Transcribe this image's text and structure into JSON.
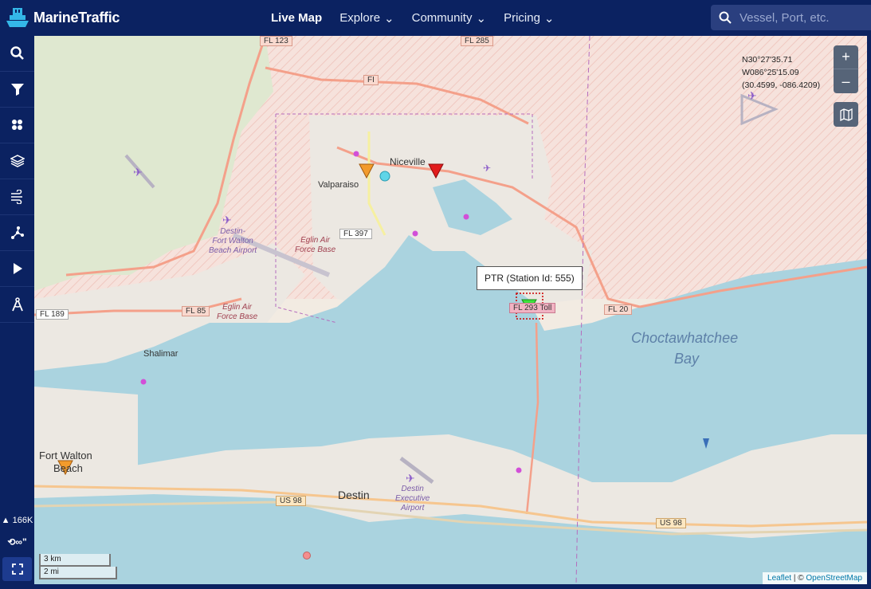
{
  "header": {
    "logo_text": "MarineTraffic",
    "nav": [
      {
        "label": "Live Map",
        "active": true
      },
      {
        "label": "Explore"
      },
      {
        "label": "Community"
      },
      {
        "label": "Pricing"
      }
    ],
    "search_placeholder": "Vessel, Port, etc."
  },
  "sidebar": {
    "items": [
      "search-icon",
      "filter-icon",
      "density-icon",
      "layers-icon",
      "wind-icon",
      "routes-icon",
      "play-icon",
      "measure-icon"
    ],
    "vessel_count": "166K",
    "infinity_label": "∞\""
  },
  "map": {
    "coords": {
      "lat": "N30°27'35.71",
      "lon": "W086°25'15.09",
      "decimal": "(30.4599, -086.4209)"
    },
    "zoom_in": "+",
    "zoom_out": "–",
    "tooltip": "PTR (Station Id: 555)",
    "scale": {
      "km": "3 km",
      "mi": "2 mi"
    },
    "attribution": {
      "leaflet": "Leaflet",
      "sep": " | © ",
      "osm": "OpenStreetMap"
    },
    "places": {
      "niceville": "Niceville",
      "valparaiso": "Valparaiso",
      "shalimar": "Shalimar",
      "fort_walton": "Fort Walton",
      "beach": "Beach",
      "destin": "Destin",
      "bay1": "Choctawhatchee",
      "bay2": "Bay",
      "airport1_l1": "Destin-",
      "airport1_l2": "Fort Walton",
      "airport1_l3": "Beach Airport",
      "eglin1_l1": "Eglin Air",
      "eglin1_l2": "Force Base",
      "eglin2_l1": "Eglin Air",
      "eglin2_l2": "Force Base",
      "destin_exec_l1": "Destin",
      "destin_exec_l2": "Executive",
      "destin_exec_l3": "Airport"
    },
    "roads": {
      "fl123": "FL 123",
      "fl285": "FL 285",
      "fl_short": "FI",
      "fl397": "FL 397",
      "fl85": "FL 85",
      "fl189": "FL 189",
      "fl20": "FL 20",
      "fl293": "FL 293 Toll",
      "us98a": "US 98",
      "us98b": "US 98"
    }
  }
}
